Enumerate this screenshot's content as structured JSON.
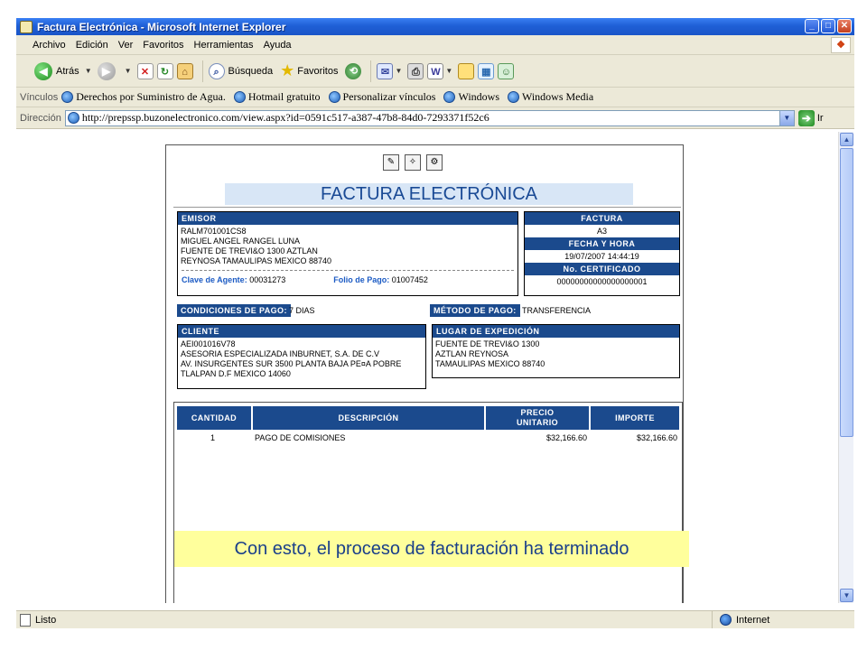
{
  "window": {
    "title": "Factura Electrónica - Microsoft Internet Explorer",
    "btn_min": "_",
    "btn_max": "□",
    "btn_close": "✕"
  },
  "menu": [
    "Archivo",
    "Edición",
    "Ver",
    "Favoritos",
    "Herramientas",
    "Ayuda"
  ],
  "toolbar": {
    "back_label": "Atrás",
    "search_label": "Búsqueda",
    "favorites_label": "Favoritos"
  },
  "links": {
    "label": "Vínculos",
    "items": [
      "Derechos por Suministro de Agua.",
      "Hotmail gratuito",
      "Personalizar vínculos",
      "Windows",
      "Windows Media"
    ]
  },
  "address": {
    "label": "Dirección",
    "url": "http://prepssp.buzonelectronico.com/view.aspx?id=0591c517-a387-47b8-84d0-7293371f52c6",
    "go_label": "Ir"
  },
  "invoice": {
    "title": "FACTURA ELECTRÓNICA",
    "emisor": {
      "header": "EMISOR",
      "lines": [
        "RALM701001CS8",
        "MIGUEL ANGEL RANGEL LUNA",
        "FUENTE DE TREVI&O 1300 AZTLAN",
        "REYNOSA TAMAULIPAS MEXICO 88740"
      ],
      "agent_label": "Clave de Agente:",
      "agent_value": "00031273",
      "folio_label": "Folio de Pago:",
      "folio_value": "01007452"
    },
    "factura": {
      "header": "FACTURA",
      "value": "A3",
      "date_header": "FECHA Y HORA",
      "date_value": "19/07/2007 14:44:19",
      "cert_header": "No. CERTIFICADO",
      "cert_value": "00000000000000000001"
    },
    "condiciones": {
      "label": "CONDICIONES DE PAGO:",
      "value": "7 DIAS"
    },
    "metodo": {
      "label": "MÉTODO DE PAGO:",
      "value": "TRANSFERENCIA"
    },
    "cliente": {
      "header": "CLIENTE",
      "lines": [
        "AEI001016V78",
        "ASESORIA ESPECIALIZADA INBURNET, S.A. DE C.V",
        "AV. INSURGENTES SUR 3500 PLANTA BAJA PE¤A POBRE",
        "TLALPAN D.F MEXICO 14060"
      ]
    },
    "expedicion": {
      "header": "LUGAR DE EXPEDICIÓN",
      "lines": [
        "FUENTE DE TREVI&O 1300",
        "AZTLAN REYNOSA",
        "TAMAULIPAS MEXICO 88740"
      ]
    },
    "table": {
      "col_cantidad": "CANTIDAD",
      "col_descripcion": "DESCRIPCIÓN",
      "col_precio": "PRECIO UNITARIO",
      "col_importe": "IMPORTE",
      "rows": [
        {
          "cantidad": "1",
          "descripcion": "PAGO DE COMISIONES",
          "precio": "$32,166.60",
          "importe": "$32,166.60"
        }
      ]
    }
  },
  "banner": "Con esto, el proceso de facturación ha terminado",
  "status": {
    "left": "Listo",
    "zone": "Internet"
  },
  "colors": {
    "header_blue": "#1b4a8d",
    "title_bg": "#d8e6f6",
    "banner_bg": "#ffff9c"
  }
}
